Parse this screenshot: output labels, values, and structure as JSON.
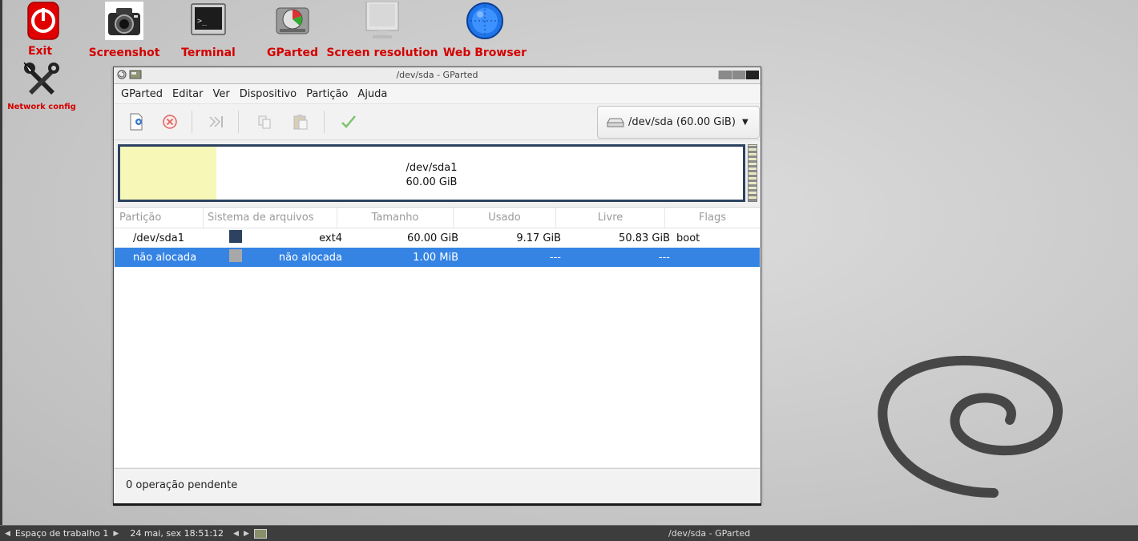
{
  "desktop": {
    "icons": [
      {
        "label": "Exit",
        "icon": "power-icon"
      },
      {
        "label": "Screenshot",
        "icon": "camera-icon"
      },
      {
        "label": "Terminal",
        "icon": "terminal-icon"
      },
      {
        "label": "GParted",
        "icon": "gparted-icon"
      },
      {
        "label": "Screen resolution",
        "icon": "monitor-icon"
      },
      {
        "label": "Web Browser",
        "icon": "globe-icon"
      },
      {
        "label": "Network config",
        "icon": "tools-icon"
      }
    ],
    "label_color": "#d40000"
  },
  "window": {
    "title": "/dev/sda - GParted",
    "menu": [
      "GParted",
      "Editar",
      "Ver",
      "Dispositivo",
      "Partição",
      "Ajuda"
    ],
    "toolbar": {
      "buttons": [
        "new-partition-icon",
        "delete-icon",
        "resize-move-icon",
        "copy-icon",
        "paste-icon",
        "apply-icon"
      ]
    },
    "device_selector": {
      "value": "/dev/sda (60.00 GiB)"
    },
    "disk_map": {
      "partition": "/dev/sda1",
      "size": "60.00 GiB"
    },
    "table": {
      "columns": [
        "Partição",
        "Sistema de arquivos",
        "Tamanho",
        "Usado",
        "Livre",
        "Flags"
      ],
      "rows": [
        {
          "partition": "/dev/sda1",
          "color": "#2c4260",
          "filesystem": "ext4",
          "size": "60.00 GiB",
          "used": "9.17 GiB",
          "free": "50.83 GiB",
          "flags": "boot",
          "selected": false
        },
        {
          "partition": "não alocada",
          "color": "#a8a8a8",
          "filesystem": "não alocada",
          "size": "1.00 MiB",
          "used": "---",
          "free": "---",
          "flags": "",
          "selected": true
        }
      ]
    },
    "status": "0 operação pendente"
  },
  "taskbar": {
    "workspace": "Espaço de trabalho 1",
    "clock": "24 mai, sex 18:51:12",
    "active_task": "/dev/sda - GParted"
  },
  "colors": {
    "accent": "#3584e4",
    "partition_border": "#2c4260",
    "used_space": "#f7f7b8"
  }
}
